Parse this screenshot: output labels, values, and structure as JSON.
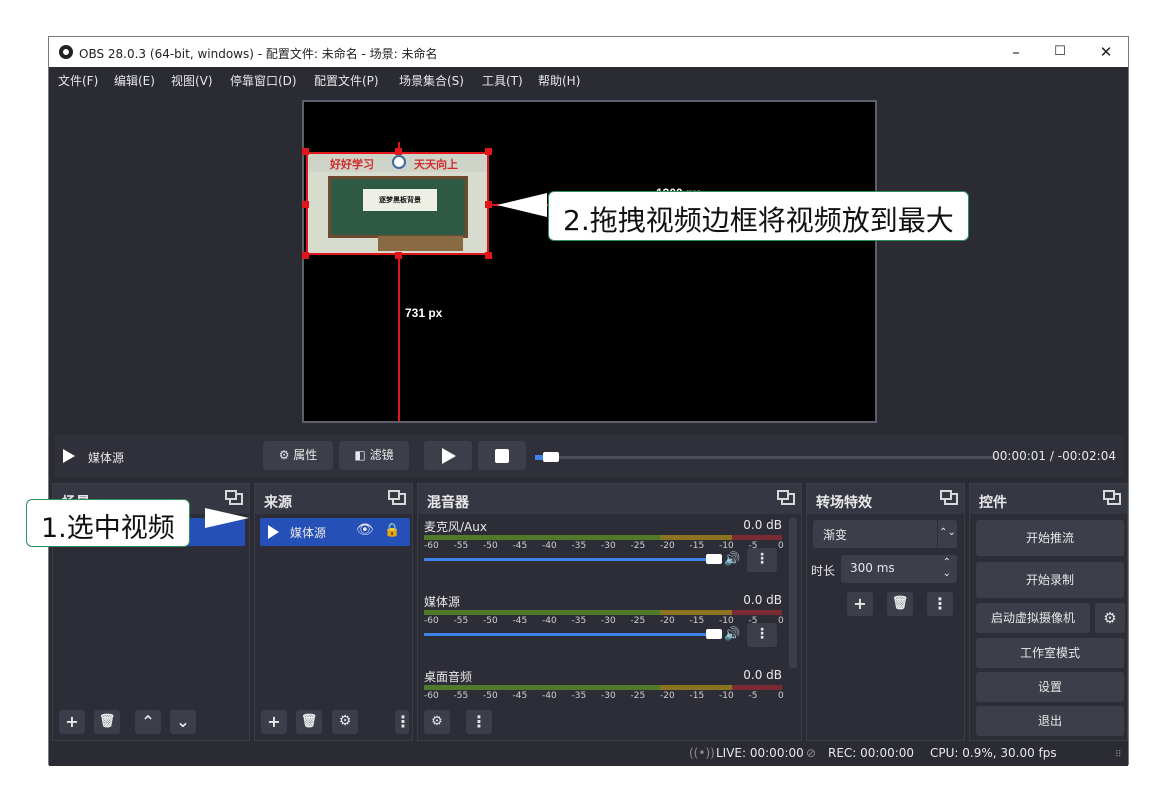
{
  "window": {
    "title": "OBS 28.0.3 (64-bit, windows) - 配置文件: 未命名 - 场景: 未命名",
    "minimize": "–",
    "maximize": "☐",
    "close": "✕"
  },
  "menu": [
    "文件(F)",
    "编辑(E)",
    "视图(V)",
    "停靠窗口(D)",
    "配置文件(P)",
    "场景集合(S)",
    "工具(T)",
    "帮助(H)"
  ],
  "preview": {
    "video_banner_left": "好好学习",
    "video_banner_right": "天天向上",
    "video_paper_text": "逐梦黑板背景",
    "width_label": "1300 px",
    "height_label": "731 px"
  },
  "callouts": {
    "step2": "2.拖拽视频边框将视频放到最大",
    "step1": "1.选中视频"
  },
  "playbar": {
    "source_name": "媒体源",
    "properties_label": "属性",
    "filters_label": "滤镜",
    "time_current": "00:00:01",
    "time_separator": "/",
    "time_remaining": "-00:02:04",
    "progress": 0.02
  },
  "docks": {
    "scenes": {
      "title": "场景"
    },
    "sources": {
      "title": "来源",
      "items": [
        {
          "label": "媒体源"
        }
      ]
    },
    "mixer": {
      "title": "混音器",
      "scale": [
        "-60",
        "-55",
        "-50",
        "-45",
        "-40",
        "-35",
        "-30",
        "-25",
        "-20",
        "-15",
        "-10",
        "-5",
        "0"
      ],
      "channels": [
        {
          "name": "麦克风/Aux",
          "db": "0.0 dB"
        },
        {
          "name": "媒体源",
          "db": "0.0 dB"
        },
        {
          "name": "桌面音频",
          "db": "0.0 dB"
        }
      ]
    },
    "transitions": {
      "title": "转场特效",
      "selected": "渐变",
      "duration_label": "时长",
      "duration_value": "300 ms"
    },
    "controls": {
      "title": "控件",
      "buttons": [
        "开始推流",
        "开始录制",
        "启动虚拟摄像机",
        "工作室模式",
        "设置",
        "退出"
      ]
    }
  },
  "status": {
    "live": "LIVE: 00:00:00",
    "rec": "REC: 00:00:00",
    "cpu": "CPU: 0.9%, 30.00 fps"
  },
  "colors": {
    "accent": "#3f82e8",
    "selection": "#e0161a",
    "callout_border": "#2f8f5f"
  }
}
